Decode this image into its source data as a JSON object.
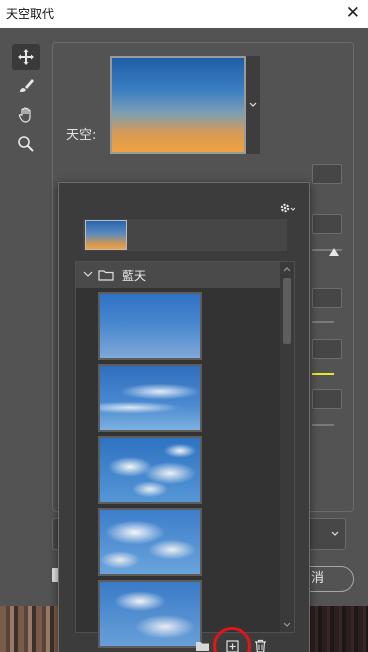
{
  "window": {
    "title": "天空取代",
    "close_glyph": "✕"
  },
  "sky": {
    "label": "天空:"
  },
  "sky_picker": {
    "group_name": "藍天",
    "presets_count_shown": 5
  },
  "actions": {
    "cancel_label": "消"
  },
  "size_slider": {
    "value_fraction": 0.14
  },
  "colors": {
    "highlight": "#e0161b",
    "accent_line": "#e8e82a"
  }
}
